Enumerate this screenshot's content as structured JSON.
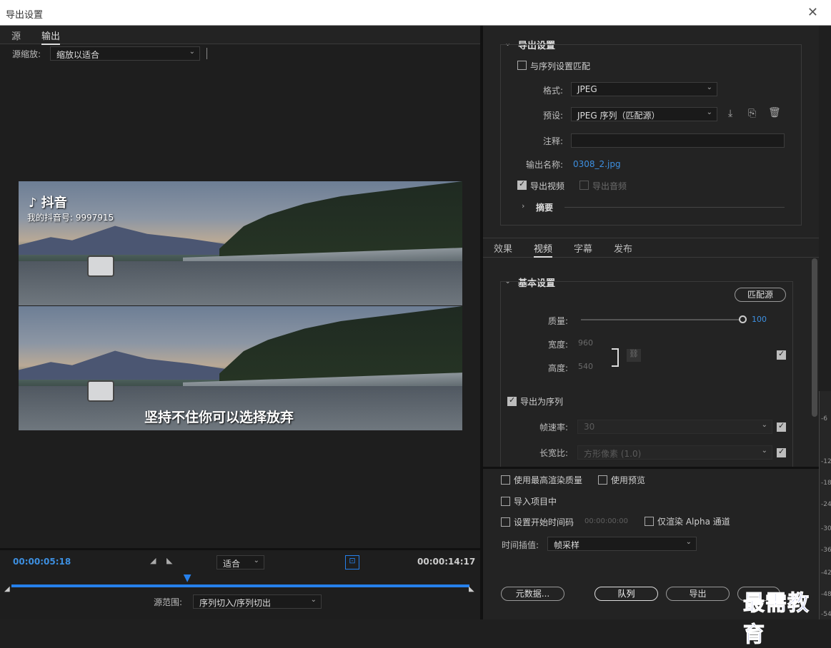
{
  "window": {
    "title": "导出设置"
  },
  "left": {
    "tabs": [
      {
        "label": "源"
      },
      {
        "label": "输出"
      }
    ],
    "source_scale_label": "源缩放:",
    "source_scale_value": "缩放以适合",
    "video_overlay": {
      "logo_text": "抖音",
      "account_text": "我的抖音号: 9997915",
      "subtitle": "坚持不住你可以选择放弃"
    },
    "timeline": {
      "current_tc": "00:00:05:18",
      "end_tc": "00:00:14:17",
      "fit_value": "适合",
      "range_label": "源范围:",
      "range_value": "序列切入/序列切出",
      "playhead_fraction": 0.385
    }
  },
  "export": {
    "section_title": "导出设置",
    "match_sequence_label": "与序列设置匹配",
    "format_label": "格式:",
    "format_value": "JPEG",
    "preset_label": "预设:",
    "preset_value": "JPEG 序列（匹配源）",
    "comment_label": "注释:",
    "comment_value": "",
    "output_name_label": "输出名称:",
    "output_name_value": "0308_2.jpg",
    "export_video_label": "导出视频",
    "export_audio_label": "导出音频",
    "summary_label": "摘要"
  },
  "video_tabs": [
    {
      "label": "效果"
    },
    {
      "label": "视频"
    },
    {
      "label": "字幕"
    },
    {
      "label": "发布"
    }
  ],
  "basic": {
    "section_title": "基本设置",
    "match_source_button": "匹配源",
    "quality_label": "质量:",
    "quality_value": "100",
    "quality_fraction": 1.0,
    "width_label": "宽度:",
    "width_value": "960",
    "height_label": "高度:",
    "height_value": "540",
    "export_sequence_label": "导出为序列",
    "framerate_label": "帧速率:",
    "framerate_value": "30",
    "aspect_label": "长宽比:",
    "aspect_value": "方形像素 (1.0)"
  },
  "bottom": {
    "max_quality_label": "使用最高渲染质量",
    "use_preview_label": "使用预览",
    "import_project_label": "导入项目中",
    "set_start_tc_label": "设置开始时间码",
    "start_tc_value": "00:00:00:00",
    "alpha_only_label": "仅渲染 Alpha 通道",
    "interp_label": "时间插值:",
    "interp_value": "帧采样",
    "metadata_button": "元数据...",
    "queue_button": "队列",
    "export_button": "导出"
  },
  "ruler": {
    "ticks": [
      "-6",
      "-12",
      "-18",
      "-24",
      "-30",
      "-36",
      "-42",
      "-48",
      "-54"
    ]
  },
  "watermark": "最需教育",
  "colors": {
    "accent": "#2680eb",
    "link": "#3d8fe0"
  }
}
